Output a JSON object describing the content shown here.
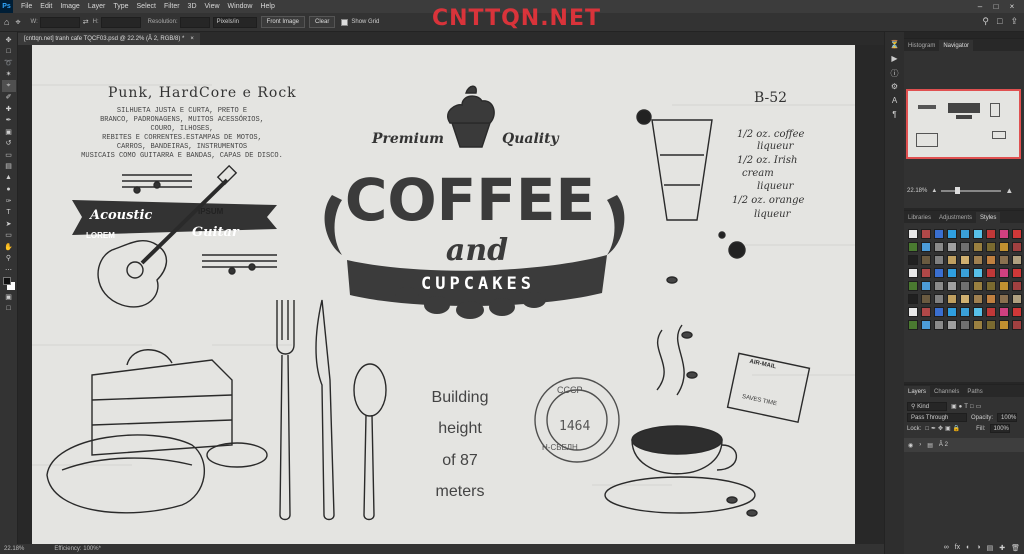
{
  "app": {
    "logo": "Ps"
  },
  "menu": [
    "File",
    "Edit",
    "Image",
    "Layer",
    "Type",
    "Select",
    "Filter",
    "3D",
    "View",
    "Window",
    "Help"
  ],
  "options": {
    "w_label": "W:",
    "h_label": "H:",
    "resolution_label": "Resolution:",
    "resolution_unit": "Pixels/in",
    "front_image": "Front Image",
    "clear": "Clear",
    "show_grid": "Show Grid"
  },
  "watermark": "CNTTQN.NET",
  "document": {
    "tab_title": "[cnttqn.net] tranh cafe TQCF03.psd @ 22.2% (Â 2, RGB/8) *",
    "close": "×"
  },
  "artwork": {
    "header": "Punk, HardCore e Rock",
    "desc": [
      "SILHUETA JUSTA E CURTA, PRETO E",
      "BRANCO, PADRONAGENS, MUITOS ACESSÓRIOS,",
      "COURO, ILHOSES,",
      "REBITES E CORRENTES.ESTAMPAS DE MOTOS,",
      "CARROS, BANDEIRAS, INSTRUMENTOS",
      "MUSICAIS COMO GUITARRA E BANDAS, CAPAS DE DISCO."
    ],
    "acoustic": "Acoustic",
    "guitar": "Guitar",
    "ipsum": "IPSUM",
    "lorem": "LOREM",
    "premium": "Premium",
    "quality": "Quality",
    "coffee": "COFFEE",
    "and": "and",
    "cupcakes": "CUPCAKES",
    "building": [
      "Building",
      "height",
      "of 87",
      "meters"
    ],
    "b52": "B-52",
    "recipe": [
      "1/2 oz. coffee",
      "liqueur",
      "1/2 oz. Irish",
      "cream",
      "liqueur",
      "1/2 oz. orange",
      "liqueur"
    ],
    "stamp_text": "CCCP",
    "stamp_num": "1464",
    "stamp_side": "Н-CБЕЛН",
    "airmail": "AIR-MAIL",
    "saves_time": "SAVES TIME"
  },
  "status": {
    "zoom": "22.18%",
    "efficiency": "Efficiency: 100%*"
  },
  "navigator": {
    "tabs": [
      "Histogram",
      "Navigator"
    ],
    "zoom": "22.18%"
  },
  "styles_panel": {
    "tabs": [
      "Libraries",
      "Adjustments",
      "Styles"
    ]
  },
  "layers_panel": {
    "tabs": [
      "Layers",
      "Channels",
      "Paths"
    ],
    "kind": "Kind",
    "blend": "Pass Through",
    "opacity_label": "Opacity:",
    "opacity": "100%",
    "lock_label": "Lock:",
    "fill_label": "Fill:",
    "fill": "100%",
    "layer_name": "Â 2"
  },
  "colors": {
    "panel_bg": "#323232",
    "accent": "#31a8ff",
    "watermark": "#e2343b"
  }
}
